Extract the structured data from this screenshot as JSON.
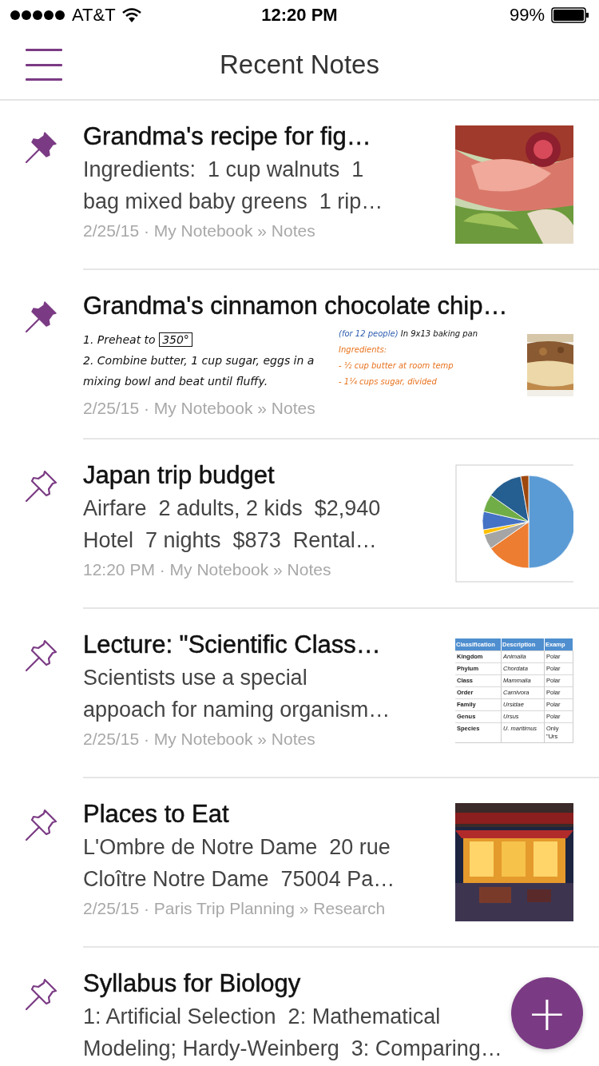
{
  "status_bar": {
    "carrier": "AT&T",
    "time": "12:20 PM",
    "battery": "99%"
  },
  "nav_bar": {
    "title": "Recent Notes"
  },
  "notes": [
    {
      "title": "Grandma's recipe for fig…",
      "pinned": true,
      "kind": "text",
      "preview_lines": [
        "Ingredients:  1 cup walnuts  1",
        "bag mixed baby greens  1 rip…"
      ],
      "meta": "2/25/15 · My Notebook » Notes",
      "thumbnail": {
        "kind": "picture"
      }
    },
    {
      "title": "Grandma's cinnamon chocolate chip…",
      "pinned": true,
      "kind": "ink",
      "ink": {
        "left": [
          {
            "segments": [
              {
                "text": "1. Preheat to ",
                "color": "#111111",
                "boxed": false
              },
              {
                "text": "350°",
                "color": "#111111",
                "boxed": true
              }
            ]
          },
          {
            "segments": [
              {
                "text": "2. Combine butter, 1 cup sugar, eggs in a",
                "color": "#111111",
                "boxed": false
              }
            ]
          },
          {
            "segments": [
              {
                "text": "mixing bowl and beat until fluffy.",
                "color": "#111111",
                "boxed": false
              }
            ]
          }
        ],
        "right": [
          {
            "segments": [
              {
                "text": "(for 12 people)",
                "color": "#2f5fb0",
                "boxed": false
              },
              {
                "text": " In 9x13 baking pan",
                "color": "#111111",
                "boxed": false
              }
            ]
          },
          {
            "segments": [
              {
                "text": "Ingredients:",
                "color": "#e8731e",
                "boxed": false
              }
            ]
          },
          {
            "segments": [
              {
                "text": "- ½ cup butter at room temp",
                "color": "#e8731e",
                "boxed": false
              }
            ]
          },
          {
            "segments": [
              {
                "text": "- 1¼ cups sugar, divided",
                "color": "#e8731e",
                "boxed": false
              }
            ]
          }
        ]
      },
      "meta": "2/25/15 · My Notebook » Notes",
      "thumbnail": {
        "kind": "picture"
      }
    },
    {
      "title": "Japan trip budget",
      "pinned": false,
      "kind": "text",
      "preview_lines": [
        "Airfare  2 adults, 2 kids  $2,940",
        "Hotel  7 nights  $873  Rental…"
      ],
      "meta": "12:20 PM · My Notebook » Notes",
      "thumbnail": {
        "kind": "chart"
      }
    },
    {
      "title": "Lecture: \"Scientific Class…",
      "pinned": false,
      "kind": "text",
      "preview_lines": [
        "Scientists use a special",
        "appoach for naming organism…"
      ],
      "meta": "2/25/15 · My Notebook » Notes",
      "thumbnail": {
        "kind": "table",
        "columns": [
          "Classification",
          "Description",
          "Examp"
        ],
        "rows": [
          [
            "Kingdom",
            "Animalia",
            "Polar"
          ],
          [
            "Phylum",
            "Chordata",
            "Polar"
          ],
          [
            "Class",
            "Mammalia",
            "Polar"
          ],
          [
            "Order",
            "Carnivora",
            "Polar"
          ],
          [
            "Family",
            "Ursidae",
            "Polar"
          ],
          [
            "Genus",
            "Ursus",
            "Polar"
          ],
          [
            "Species",
            "U. maritimus",
            "Only \"Urs"
          ]
        ]
      }
    },
    {
      "title": "Places to Eat",
      "pinned": false,
      "kind": "text",
      "preview_lines": [
        "L'Ombre de Notre Dame  20 rue",
        "Cloître Notre Dame  75004 Pa…"
      ],
      "meta": "2/25/15 · Paris Trip Planning » Research",
      "thumbnail": {
        "kind": "picture"
      }
    },
    {
      "title": "Syllabus for Biology",
      "pinned": false,
      "kind": "text",
      "preview_lines": [
        "1: Artificial Selection  2: Mathematical",
        "Modeling; Hardy-Weinberg  3: Comparing…"
      ]
    }
  ],
  "fab": {
    "label": "+"
  }
}
